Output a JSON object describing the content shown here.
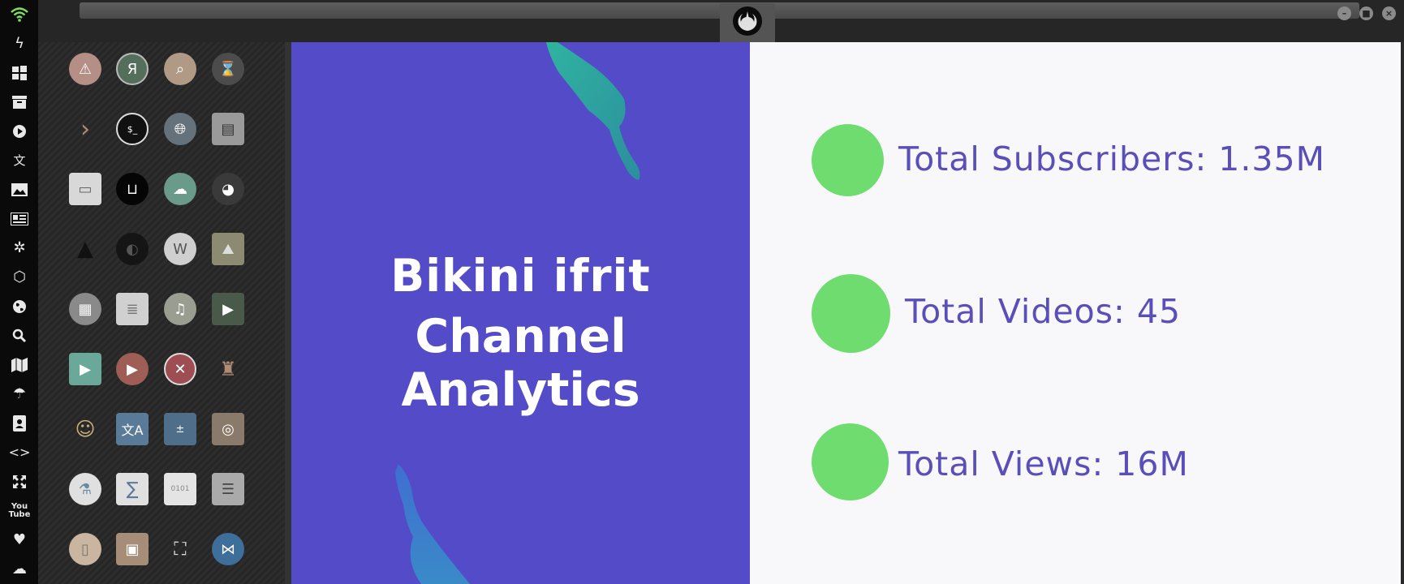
{
  "dock": {
    "icons": [
      "wifi-icon",
      "lightning-icon",
      "windows-icon",
      "archive-icon",
      "play-circle-icon",
      "translate-icon",
      "image-icon",
      "news-icon",
      "empire-icon",
      "hexagon-icon",
      "globe-icon",
      "search-icon",
      "map-icon",
      "umbrella-icon",
      "contacts-icon",
      "code-icon",
      "expand-icon",
      "youtube-icon",
      "heart-icon",
      "cloud-icon"
    ]
  },
  "window": {
    "logo": "rebel-alliance-icon",
    "controls": [
      "minimize",
      "maximize",
      "close"
    ]
  },
  "app_grid": {
    "apps": [
      [
        "warning-icon",
        "yandex-browser-icon",
        "search-icon",
        "hourglass-icon"
      ],
      [
        "terminal-chevron-icon",
        "terminal-icon",
        "globe-icon",
        "file-cabinet-icon"
      ],
      [
        "window-icon",
        "bracket-app-icon",
        "cloud-lock-icon",
        "github-icon"
      ],
      [
        "starfleet-icon",
        "death-star-icon",
        "wikipedia-icon",
        "world-map-icon"
      ],
      [
        "document-stack-icon",
        "notebook-icon",
        "music-icon",
        "video-icon"
      ],
      [
        "media-player-icon",
        "video-player-icon",
        "close-circle-icon",
        "droid-icon"
      ],
      [
        "c3po-icon",
        "translator-icon",
        "calculator-icon",
        "camera-app-icon"
      ],
      [
        "lab-flask-icon",
        "sigma-icon",
        "binary-file-icon",
        "text-editor-icon"
      ],
      [
        "document-icon",
        "image-viewer-icon",
        "presentation-icon",
        "vscode-icon"
      ]
    ]
  },
  "slide": {
    "title_line1": "Bikini ifrit",
    "title_line2": "Channel Analytics",
    "stats": [
      "Total Subscribers: 1.35M",
      "Total Videos: 45",
      "Total Views: 16M"
    ],
    "colors": {
      "left_bg": "#534bc7",
      "dot": "#6fdc6f",
      "stat_text": "#5a4fb8"
    }
  }
}
